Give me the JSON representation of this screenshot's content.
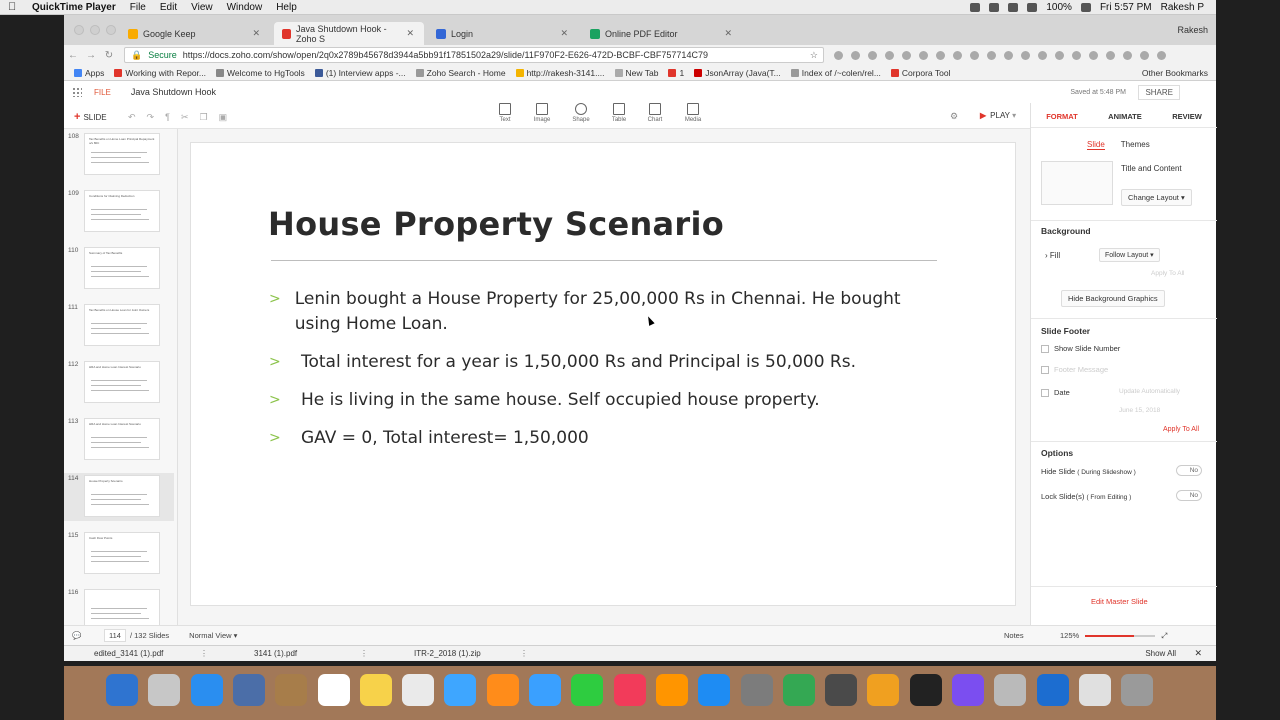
{
  "menubar": {
    "app_name": "QuickTime Player",
    "items": [
      "File",
      "Edit",
      "View",
      "Window",
      "Help"
    ],
    "battery": "100%",
    "clock": "Fri 5:57 PM",
    "user": "Rakesh P"
  },
  "browser": {
    "tabs": [
      {
        "label": "Google Keep",
        "color": "#f9ab00"
      },
      {
        "label": "Java Shutdown Hook - Zoho S",
        "color": "#e0352b"
      },
      {
        "label": "Login",
        "color": "#3367d6"
      },
      {
        "label": "Online PDF Editor",
        "color": "#1aa260"
      }
    ],
    "profile": "Rakesh",
    "secure_label": "Secure",
    "url": "https://docs.zoho.com/show/open/2q0x2789b45678d3944a5bb91f17851502a29/slide/11F970F2-E626-472D-BCBF-CBF757714C79",
    "bookmarks": [
      {
        "label": "Apps",
        "color": "#4285f4"
      },
      {
        "label": "Working with Repor...",
        "color": "#e0352b"
      },
      {
        "label": "Welcome to HgTools",
        "color": "#888888"
      },
      {
        "label": "(1) Interview apps -...",
        "color": "#3b5998"
      },
      {
        "label": "Zoho Search - Home",
        "color": "#999999"
      },
      {
        "label": "http://rakesh-3141....",
        "color": "#f4b400"
      },
      {
        "label": "New Tab",
        "color": "#aaaaaa"
      },
      {
        "label": "1",
        "color": "#e0352b"
      },
      {
        "label": "JsonArray (Java(T...",
        "color": "#cc0000"
      },
      {
        "label": "Index of /~colen/rel...",
        "color": "#999999"
      },
      {
        "label": "Corpora Tool",
        "color": "#e0352b"
      }
    ],
    "other_bookmarks": "Other Bookmarks"
  },
  "zoho": {
    "file_menu": "FILE",
    "doc_title": "Java Shutdown Hook",
    "saved_text": "Saved at 5:48 PM",
    "share": "SHARE",
    "slide_button": "SLIDE",
    "insert_tools": [
      "Text",
      "Image",
      "Shape",
      "Table",
      "Chart",
      "Media"
    ],
    "play": "PLAY"
  },
  "panel": {
    "tabs": [
      "FORMAT",
      "ANIMATE",
      "REVIEW"
    ],
    "subtabs": [
      "Slide",
      "Themes"
    ],
    "layout_name": "Title and Content",
    "change_layout": "Change Layout",
    "background_title": "Background",
    "fill_label": "Fill",
    "fill_value": "Follow Layout",
    "apply_to_all_faint": "Apply To All",
    "hide_bg": "Hide Background Graphics",
    "footer_title": "Slide Footer",
    "show_slide_number": "Show Slide Number",
    "footer_message": "Footer Message",
    "date_label": "Date",
    "date_auto": "Update Automatically",
    "date_value": "June 15, 2018",
    "apply_to_all": "Apply To All",
    "options_title": "Options",
    "hide_slide": "Hide Slide",
    "hide_slide_sub": "( During Slideshow )",
    "lock_slide": "Lock Slide(s)",
    "lock_slide_sub": "( From Editing )",
    "toggle_no": "No",
    "edit_master": "Edit Master Slide"
  },
  "thumbnails": [
    {
      "num": "108",
      "title": "Tax Benefits on Home Loan Principal Repayment u/s 80C"
    },
    {
      "num": "109",
      "title": "Conditions for Claiming Deduction"
    },
    {
      "num": "110",
      "title": "Summary of Tax Benefits"
    },
    {
      "num": "111",
      "title": "Tax Benefits on House Loan for Joint Owners"
    },
    {
      "num": "112",
      "title": "HRA and Home Loan Interest Scenario"
    },
    {
      "num": "113",
      "title": "HRA and Home Loan Interest Scenario"
    },
    {
      "num": "114",
      "title": "House Property Scenario"
    },
    {
      "num": "115",
      "title": "Cash Flow Points"
    },
    {
      "num": "116",
      "title": ""
    }
  ],
  "slide": {
    "title": "House Property Scenario",
    "bullets": [
      "Lenin bought a House Property for 25,00,000 Rs in Chennai. He bought using Home Loan.",
      "Total interest for a year is 1,50,000 Rs and Principal is 50,000 Rs.",
      "He is living in the same house. Self occupied house property.",
      "GAV = 0, Total interest= 1,50,000"
    ],
    "bullet_glyph": ">"
  },
  "status": {
    "current": "114",
    "total": "/ 132 Slides",
    "view_mode": "Normal View",
    "notes": "Notes",
    "zoom": "125%",
    "zoom_fraction": 0.7
  },
  "downloads": {
    "items": [
      "edited_3141 (1).pdf",
      "3141 (1).pdf",
      "ITR-2_2018 (1).zip"
    ],
    "show_all": "Show All"
  },
  "dock": {
    "colors": [
      "#2f74d0",
      "#c7c7c7",
      "#2a8ef0",
      "#4b6ea8",
      "#a77d4a",
      "#ffffff",
      "#f7d24a",
      "#eaeaea",
      "#3ea6ff",
      "#ff8c1a",
      "#3aa0ff",
      "#2ecc40",
      "#f23b5a",
      "#ff9500",
      "#1e8cf3",
      "#7c7c7c",
      "#34a853",
      "#4a4a4a",
      "#f0a020",
      "#222222",
      "#7b4ef0",
      "#bababa",
      "#1c6dd0",
      "#e0e0e0",
      "#9a9a9a"
    ]
  }
}
